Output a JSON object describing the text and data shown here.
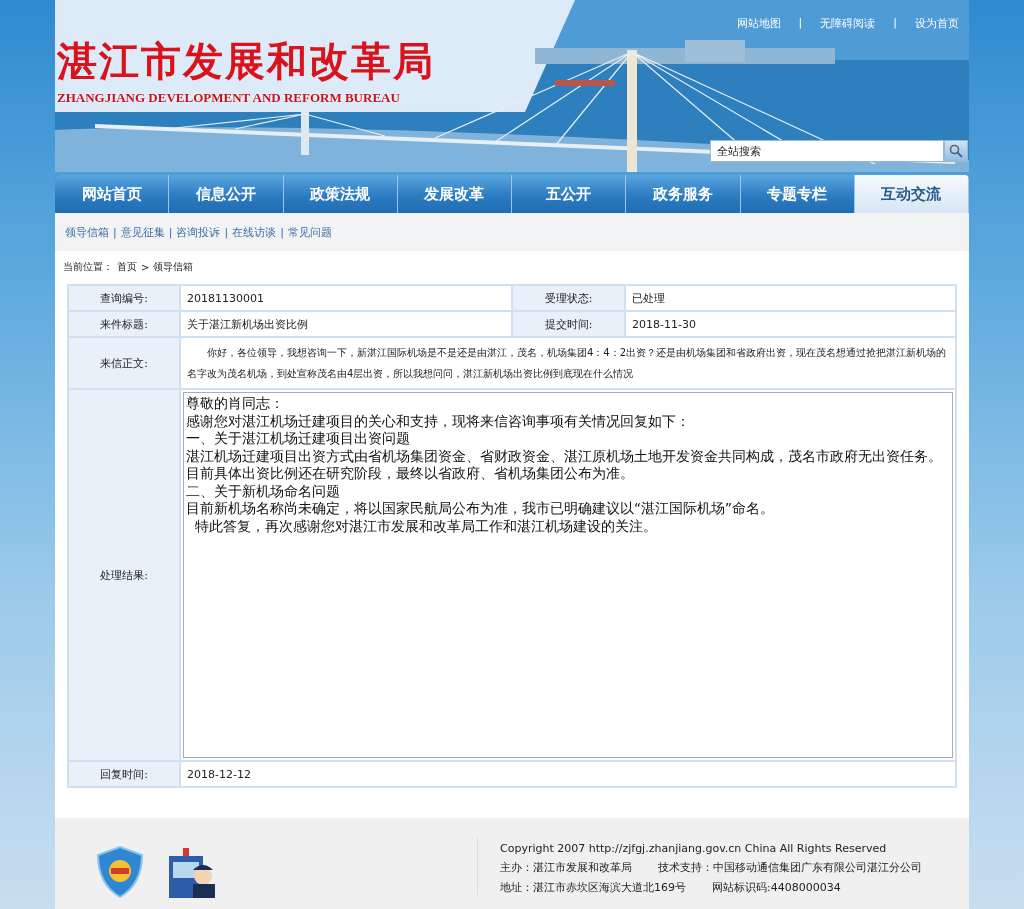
{
  "header": {
    "title": "湛江市发展和改革局",
    "subtitle": "ZHANGJIANG DEVELOPMENT AND REFORM BUREAU",
    "top_links": [
      "网站地图",
      "无障碍阅读",
      "设为首页"
    ],
    "separator": "|",
    "search": {
      "placeholder": "全站搜索"
    }
  },
  "nav": [
    {
      "label": "网站首页",
      "selected": false
    },
    {
      "label": "信息公开",
      "selected": false
    },
    {
      "label": "政策法规",
      "selected": false
    },
    {
      "label": "发展改革",
      "selected": false
    },
    {
      "label": "五公开",
      "selected": false
    },
    {
      "label": "政务服务",
      "selected": false
    },
    {
      "label": "专题专栏",
      "selected": false
    },
    {
      "label": "互动交流",
      "selected": true
    }
  ],
  "sub_links": [
    "领导信箱",
    "意见征集",
    "咨询投诉",
    "在线访谈",
    "常见问题"
  ],
  "sub_separator": "|",
  "breadcrumb": {
    "label": "当前位置：",
    "items": [
      "首页",
      "领导信箱"
    ],
    "separator": ">"
  },
  "record": {
    "query_no": {
      "label": "查询编号:",
      "value": "20181130001"
    },
    "status": {
      "label": "受理状态:",
      "value": "已处理"
    },
    "subject": {
      "label": "来件标题:",
      "value": "关于湛江新机场出资比例"
    },
    "submitted": {
      "label": "提交时间:",
      "value": "2018-11-30"
    },
    "body": {
      "label": "来信正文:",
      "value": "你好，各位领导，我想咨询一下，新湛江国际机场是不是还是由湛江，茂名，机场集团4：4：2出资？还是由机场集团和省政府出资，现在茂名想通过抢把湛江新机场的名字改为茂名机场，到处宣称茂名由4层出资，所以我想问问，湛江新机场出资比例到底现在什么情况"
    },
    "result": {
      "label": "处理结果:",
      "lines": [
        "尊敬的肖同志：",
        "感谢您对湛江机场迁建项目的关心和支持，现将来信咨询事项有关情况回复如下：",
        "一、关于湛江机场迁建项目出资问题",
        "湛江机场迁建项目出资方式由省机场集团资金、省财政资金、湛江原机场土地开发资金共同构成，茂名市政府无出资任务。目前具体出资比例还在研究阶段，最终以省政府、省机场集团公布为准。",
        "二、关于新机场命名问题",
        "目前新机场名称尚未确定，将以国家民航局公布为准，我市已明确建议以“湛江国际机场”命名。",
        "  特此答复，再次感谢您对湛江市发展和改革局工作和湛江机场建设的关注。"
      ]
    },
    "replied": {
      "label": "回复时间:",
      "value": "2018-12-12"
    }
  },
  "footer": {
    "copyright": "Copyright 2007 http://zjfgj.zhanjiang.gov.cn China All Rights Reserved",
    "host": "主办：湛江市发展和改革局",
    "support": "技术支持：中国移动通信集团广东有限公司湛江分公司",
    "address": "地址：湛江市赤坎区海滨大道北169号",
    "site_code": "网站标识码:4408000034"
  }
}
